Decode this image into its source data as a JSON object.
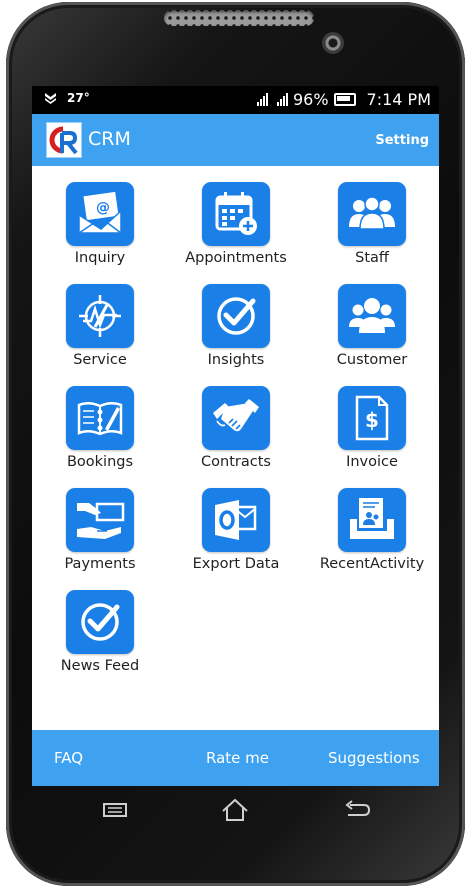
{
  "status_bar": {
    "temperature": "27°",
    "battery_percent": "96%",
    "time": "7:14 PM"
  },
  "app_bar": {
    "title": "CRM",
    "setting_label": "Setting"
  },
  "tiles": [
    {
      "label": "Inquiry",
      "icon": "email-icon"
    },
    {
      "label": "Appointments",
      "icon": "calendar-add-icon"
    },
    {
      "label": "Staff",
      "icon": "people-icon"
    },
    {
      "label": "Service",
      "icon": "service-gauge-icon"
    },
    {
      "label": "Insights",
      "icon": "checkmark-icon"
    },
    {
      "label": "Customer",
      "icon": "customers-group-icon"
    },
    {
      "label": "Bookings",
      "icon": "book-icon"
    },
    {
      "label": "Contracts",
      "icon": "handshake-icon"
    },
    {
      "label": "Invoice",
      "icon": "invoice-dollar-icon"
    },
    {
      "label": "Payments",
      "icon": "hand-money-icon"
    },
    {
      "label": "Export Data",
      "icon": "outlook-export-icon"
    },
    {
      "label": "RecentActivity",
      "icon": "inbox-contacts-icon"
    },
    {
      "label": "News Feed",
      "icon": "checkmark-icon"
    }
  ],
  "footer": {
    "faq": "FAQ",
    "rate": "Rate me",
    "suggestions": "Suggestions"
  },
  "colors": {
    "app_bar": "#3ea2f0",
    "tile": "#1a7fe6",
    "footer": "#3ea2f0"
  }
}
